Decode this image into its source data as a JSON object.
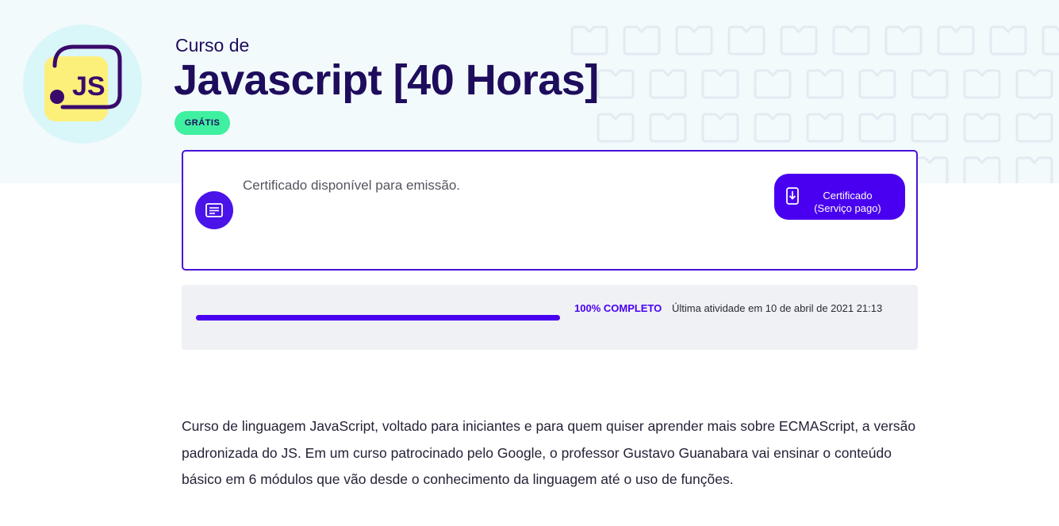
{
  "course": {
    "subtitle": "Curso de",
    "title": "Javascript [40 Horas]",
    "badge": "GRÁTIS",
    "logo_text": "JS",
    "logo_icon": "js-logo-icon"
  },
  "certificate": {
    "message": "Certificado disponível para emissão.",
    "icon": "certificate-icon",
    "button": {
      "line1": "Certificado",
      "line2": "(Serviço pago)",
      "icon": "download-icon"
    }
  },
  "progress": {
    "percent": 100,
    "label": "100% COMPLETO",
    "last_activity": "Última atividade em 10 de abril de 2021 21:13"
  },
  "description": "Curso de linguagem JavaScript, voltado para iniciantes e para quem quiser aprender mais sobre ECMAScript, a versão padronizada do JS. Em um curso patrocinado pelo Google, o professor Gustavo Guanabara vai ensinar o conteúdo básico em 6 módulos que vão desde o conhecimento da linguagem até o uso de funções.",
  "colors": {
    "accent": "#4a00f0",
    "badge": "#3ef0a0",
    "title": "#1e0c5c",
    "hero_bg": "#f3fafc",
    "logo_yellow": "#fdf07a",
    "logo_bg": "#d9f6f8"
  }
}
